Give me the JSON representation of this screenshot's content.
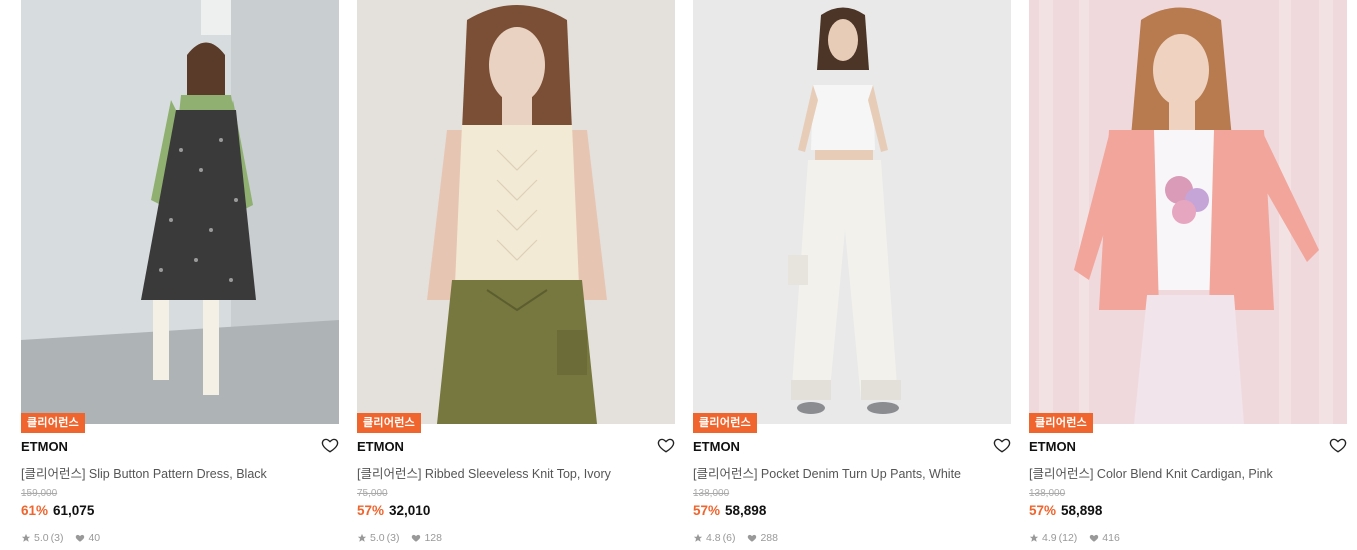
{
  "products": [
    {
      "badge": "클리어런스",
      "brand": "ETMON",
      "title": "[클리어런스] Slip Button Pattern Dress, Black",
      "original_price": "159,000",
      "discount": "61%",
      "price": "61,075",
      "rating": "5.0",
      "review_count": "(3)",
      "likes": "40"
    },
    {
      "badge": "클리어런스",
      "brand": "ETMON",
      "title": "[클리어런스] Ribbed Sleeveless Knit Top, Ivory",
      "original_price": "75,000",
      "discount": "57%",
      "price": "32,010",
      "rating": "5.0",
      "review_count": "(3)",
      "likes": "128"
    },
    {
      "badge": "클리어런스",
      "brand": "ETMON",
      "title": "[클리어런스] Pocket Denim Turn Up Pants, White",
      "original_price": "138,000",
      "discount": "57%",
      "price": "58,898",
      "rating": "4.8",
      "review_count": "(6)",
      "likes": "288"
    },
    {
      "badge": "클리어런스",
      "brand": "ETMON",
      "title": "[클리어런스] Color Blend Knit Cardigan, Pink",
      "original_price": "138,000",
      "discount": "57%",
      "price": "58,898",
      "rating": "4.9",
      "review_count": "(12)",
      "likes": "416"
    }
  ],
  "colors": {
    "accent": "#f0642d",
    "muted_text": "#999999"
  },
  "icons": {
    "like": "heart-outline-icon",
    "rating": "star-icon",
    "likes_count": "heart-filled-icon"
  }
}
